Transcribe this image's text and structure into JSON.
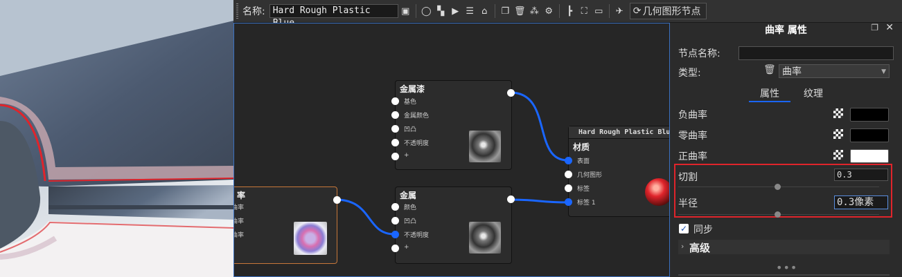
{
  "toolbar": {
    "name_label": "名称:",
    "name_value": "Hard Rough Plastic Blue",
    "mode_dropdown": "几何图形节点"
  },
  "nodes": {
    "curvature": {
      "title": "率",
      "ports": [
        "曲率",
        "曲率",
        "曲率"
      ]
    },
    "metallic_paint": {
      "title": "金属漆",
      "ports": [
        "基色",
        "金属颜色",
        "凹凸",
        "不透明度",
        "+"
      ]
    },
    "metal": {
      "title": "金属",
      "ports": [
        "颜色",
        "凹凸",
        "不透明度",
        "+"
      ]
    },
    "material_output": {
      "header": "Hard Rough Plastic Blu",
      "title": "材质",
      "ports": [
        "表面",
        "几何图形",
        "标签",
        "标签 1"
      ]
    }
  },
  "panel": {
    "title": "曲率 属性",
    "node_name_label": "节点名称:",
    "node_name_value": "",
    "type_label": "类型:",
    "type_value": "曲率",
    "tabs": [
      "属性",
      "纹理"
    ],
    "active_tab": "属性",
    "negative_curvature_label": "负曲率",
    "zero_curvature_label": "零曲率",
    "positive_curvature_label": "正曲率",
    "colors": {
      "negative": "#000000",
      "zero": "#000000",
      "positive": "#ffffff",
      "highlight": "#e0242b",
      "accent": "#1a66ff"
    },
    "cut_label": "切割",
    "cut_value": "0.3",
    "radius_label": "半径",
    "radius_value": "0.3像素",
    "sync_label": "同步",
    "sync_checked": true,
    "advanced_label": "高级"
  }
}
